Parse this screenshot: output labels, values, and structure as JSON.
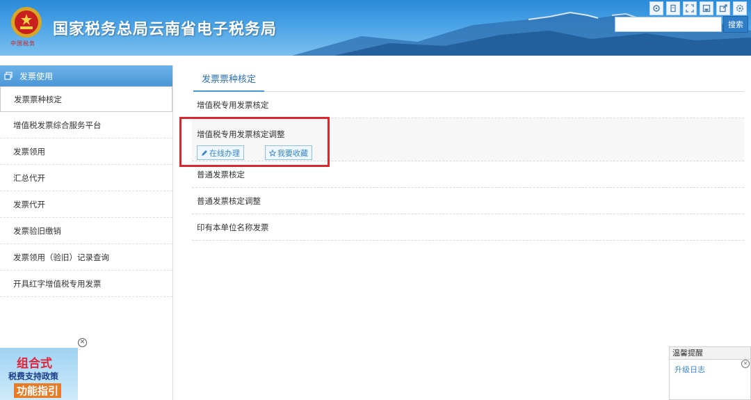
{
  "header": {
    "title": "国家税务总局云南省电子税务局",
    "emblem_caption": "中国税务",
    "search_button": "搜索",
    "search_placeholder": "",
    "toolbar_icons": [
      "refresh-icon",
      "bookmark-icon",
      "fullscreen-icon",
      "save-icon",
      "share-icon",
      "settings-icon"
    ]
  },
  "sidebar": {
    "heading": "发票使用",
    "items": [
      {
        "label": "发票票种核定",
        "active": true
      },
      {
        "label": "增值税发票综合服务平台"
      },
      {
        "label": "发票领用"
      },
      {
        "label": "汇总代开"
      },
      {
        "label": "发票代开"
      },
      {
        "label": "发票验旧缴销"
      },
      {
        "label": "发票领用（验旧）记录查询"
      },
      {
        "label": "开具红字增值税专用发票"
      }
    ]
  },
  "promo": {
    "line1": "组合式",
    "line2": "税费支持政策",
    "line3": "功能指引"
  },
  "main": {
    "tab": "发票票种核定",
    "rows": [
      {
        "label": "增值税专用发票核定"
      },
      {
        "label": "增值税专用发票核定调整",
        "actions": {
          "online": "在线办理",
          "favorite": "我要收藏"
        }
      },
      {
        "label": "普通发票核定"
      },
      {
        "label": "普通发票核定调整"
      },
      {
        "label": "印有本单位名称发票"
      }
    ]
  },
  "reminder": {
    "title": "温馨提醒",
    "link": "升级日志"
  },
  "colors": {
    "accent": "#4a97d6",
    "highlight": "#d9272e",
    "link": "#3a86c8"
  }
}
